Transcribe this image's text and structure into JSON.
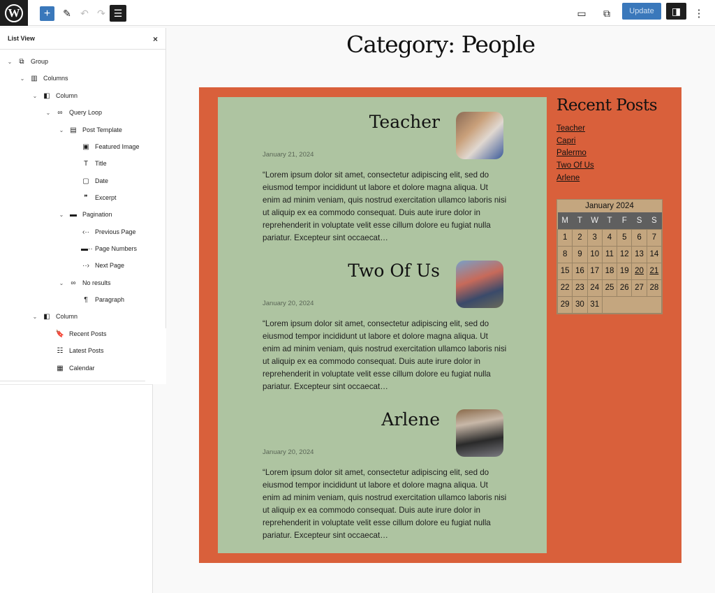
{
  "topbar": {
    "logo": "W",
    "add_icon": "+",
    "edit_icon": "✎",
    "undo_icon": "↶",
    "redo_icon": "↷",
    "list_icon": "☰",
    "view_icon": "▭",
    "preview_icon": "⧉",
    "update_label": "Update",
    "settings_icon": "◨",
    "more_icon": "⋮"
  },
  "list_view": {
    "title": "List View",
    "close_icon": "×",
    "items": [
      {
        "label": "Group",
        "icon": "⧉",
        "chev": "⌄"
      },
      {
        "label": "Columns",
        "icon": "▥",
        "chev": "⌄"
      },
      {
        "label": "Column",
        "icon": "◧",
        "chev": "⌄"
      },
      {
        "label": "Query Loop",
        "icon": "∞",
        "chev": "⌄"
      },
      {
        "label": "Post Template",
        "icon": "▤",
        "chev": "⌄"
      },
      {
        "label": "Featured Image",
        "icon": "▣",
        "chev": ""
      },
      {
        "label": "Title",
        "icon": "T",
        "chev": ""
      },
      {
        "label": "Date",
        "icon": "▢",
        "chev": ""
      },
      {
        "label": "Excerpt",
        "icon": "❞",
        "chev": ""
      },
      {
        "label": "Pagination",
        "icon": "▬",
        "chev": "⌄"
      },
      {
        "label": "Previous Page",
        "icon": "‹··",
        "chev": ""
      },
      {
        "label": "Page Numbers",
        "icon": "▬··",
        "chev": ""
      },
      {
        "label": "Next Page",
        "icon": "··›",
        "chev": ""
      },
      {
        "label": "No results",
        "icon": "∞",
        "chev": "⌄"
      },
      {
        "label": "Paragraph",
        "icon": "¶",
        "chev": ""
      },
      {
        "label": "Column",
        "icon": "◧",
        "chev": "⌄"
      },
      {
        "label": "Recent Posts",
        "icon": "🔖",
        "chev": ""
      },
      {
        "label": "Latest Posts",
        "icon": "☷",
        "chev": ""
      },
      {
        "label": "Calendar",
        "icon": "▦",
        "chev": ""
      }
    ]
  },
  "page": {
    "title": "Category: People",
    "colors": {
      "outer": "#d9603b",
      "inner": "#aec4a1",
      "calendar": "#c4a67f",
      "calendar_header": "#5f5f5f"
    },
    "posts": [
      {
        "title": "Teacher",
        "date": "January 21, 2024",
        "excerpt": "“Lorem ipsum dolor sit amet, consectetur adipiscing elit, sed do eiusmod tempor incididunt ut labore et dolore magna aliqua. Ut enim ad minim veniam, quis nostrud exercitation ullamco laboris nisi ut aliquip ex ea commodo consequat. Duis aute irure dolor in reprehenderit in voluptate velit esse cillum dolore eu fugiat nulla pariatur. Excepteur sint occaecat…"
      },
      {
        "title": "Two Of Us",
        "date": "January 20, 2024",
        "excerpt": "“Lorem ipsum dolor sit amet, consectetur adipiscing elit, sed do eiusmod tempor incididunt ut labore et dolore magna aliqua. Ut enim ad minim veniam, quis nostrud exercitation ullamco laboris nisi ut aliquip ex ea commodo consequat. Duis aute irure dolor in reprehenderit in voluptate velit esse cillum dolore eu fugiat nulla pariatur. Excepteur sint occaecat…"
      },
      {
        "title": "Arlene",
        "date": "January 20, 2024",
        "excerpt": "“Lorem ipsum dolor sit amet, consectetur adipiscing elit, sed do eiusmod tempor incididunt ut labore et dolore magna aliqua. Ut enim ad minim veniam, quis nostrud exercitation ullamco laboris nisi ut aliquip ex ea commodo consequat. Duis aute irure dolor in reprehenderit in voluptate velit esse cillum dolore eu fugiat nulla pariatur. Excepteur sint occaecat…"
      }
    ],
    "recent_posts": {
      "title": "Recent Posts",
      "links": [
        "Teacher",
        "Capri",
        "Palermo",
        "Two Of Us",
        "Arlene"
      ]
    },
    "calendar": {
      "caption": "January 2024",
      "weekdays": [
        "M",
        "T",
        "W",
        "T",
        "F",
        "S",
        "S"
      ],
      "first_weekday_offset": 0,
      "days_in_month": 31,
      "linked_days": [
        20,
        21
      ]
    }
  }
}
